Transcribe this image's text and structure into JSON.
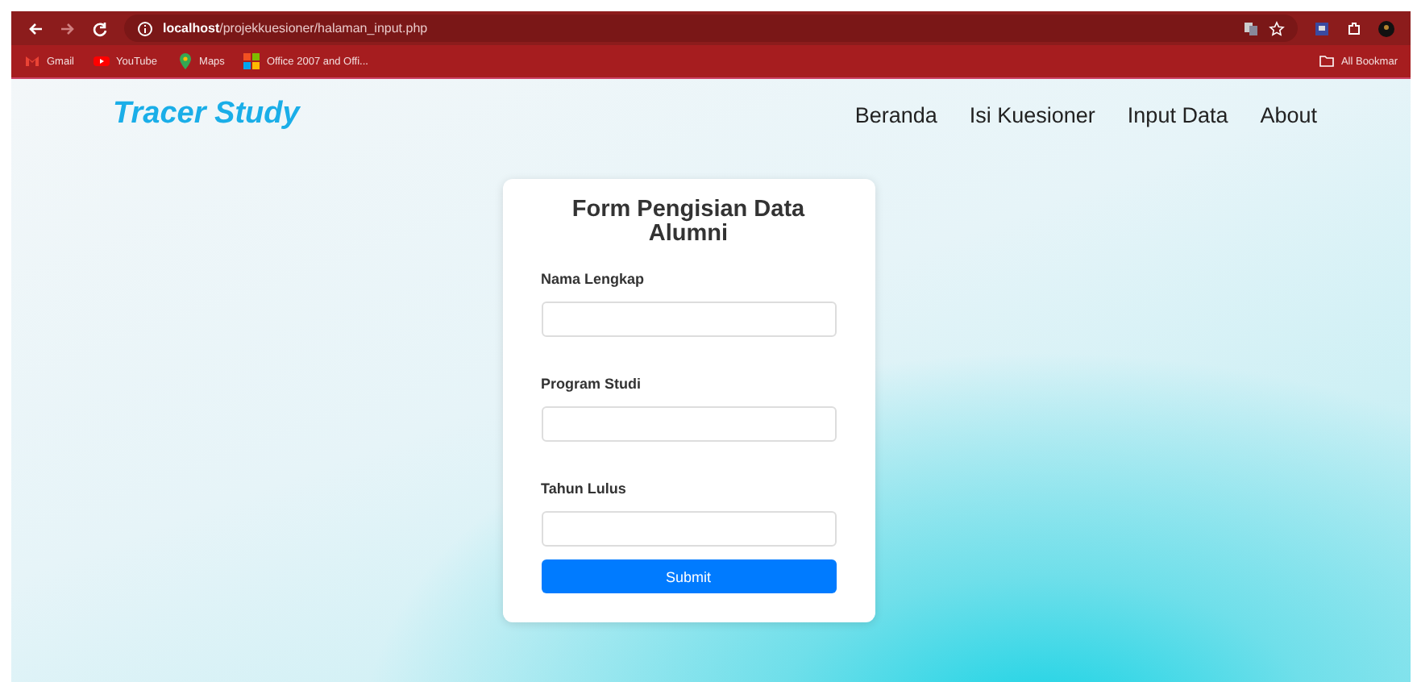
{
  "browser": {
    "url_host": "localhost",
    "url_path": "/projekkuesioner/halaman_input.php",
    "bookmarks": [
      {
        "label": "Gmail",
        "kind": "gmail"
      },
      {
        "label": "YouTube",
        "kind": "youtube"
      },
      {
        "label": "Maps",
        "kind": "maps"
      },
      {
        "label": "Office 2007 and Offi...",
        "kind": "office"
      }
    ],
    "all_bookmarks": "All Bookmar"
  },
  "navbar": {
    "brand": "Tracer Study",
    "links": [
      "Beranda",
      "Isi Kuesioner",
      "Input Data",
      "About"
    ]
  },
  "form": {
    "title": "Form Pengisian Data Alumni",
    "fields": [
      {
        "label": "Nama Lengkap"
      },
      {
        "label": "Program Studi"
      },
      {
        "label": "Tahun Lulus"
      }
    ],
    "submit": "Submit"
  }
}
